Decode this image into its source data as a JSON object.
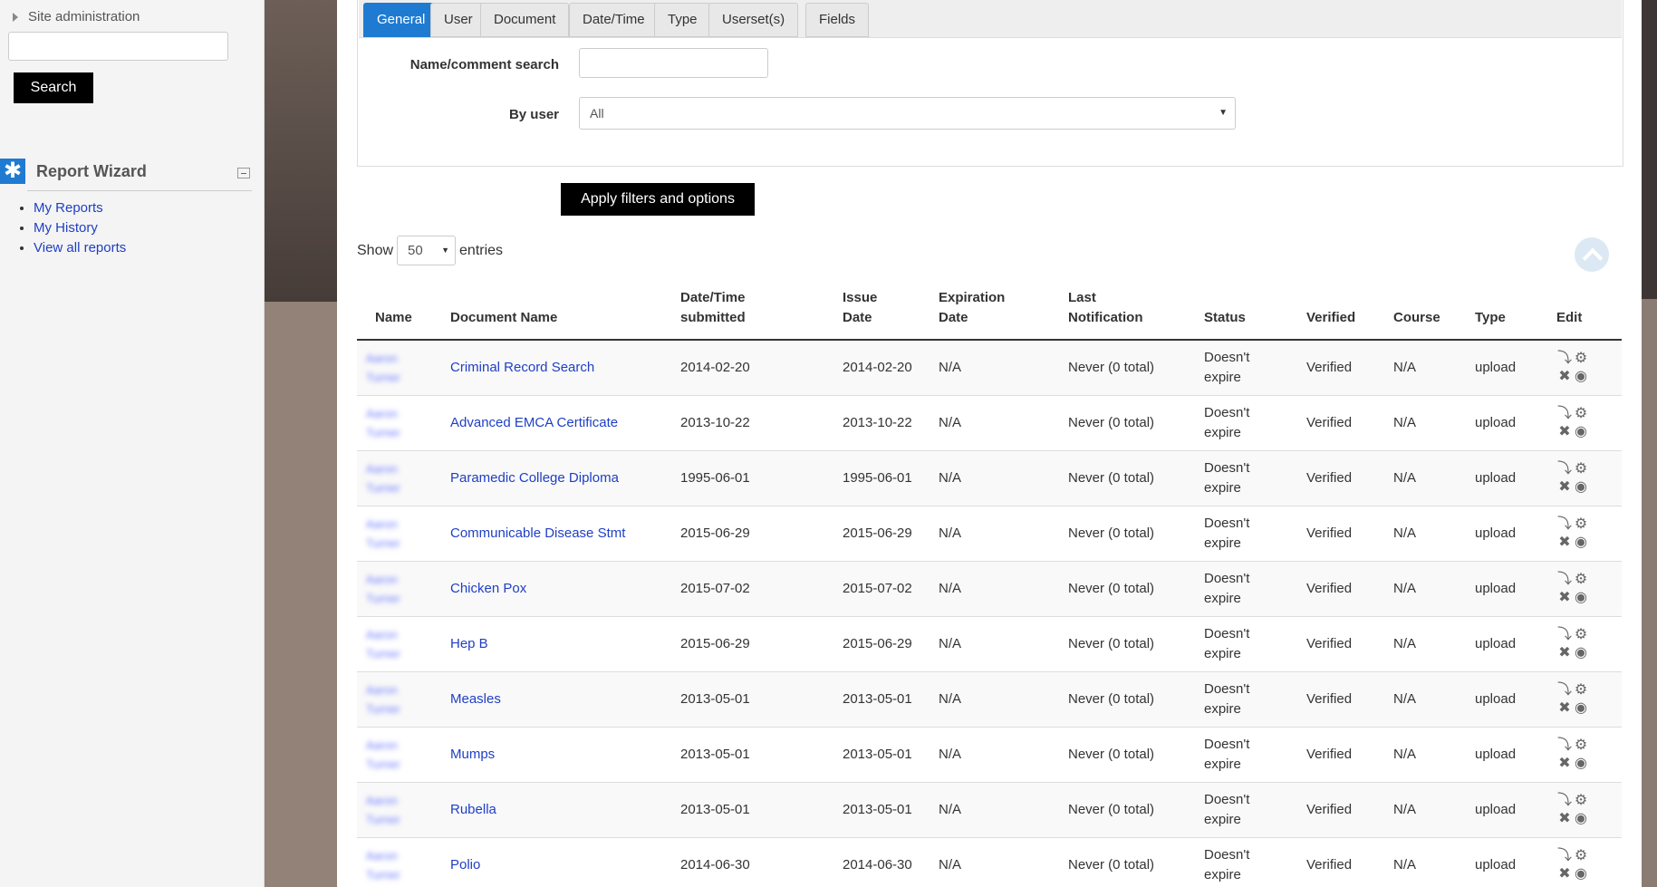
{
  "sidebar": {
    "site_admin_label": "Site administration",
    "search_button": "Search",
    "report_wizard": {
      "title": "Report Wizard",
      "links": [
        "My Reports",
        "My History",
        "View all reports"
      ]
    }
  },
  "filters": {
    "tabs": [
      "General",
      "User",
      "Document",
      "Date/Time",
      "Type",
      "Userset(s)",
      "Fields"
    ],
    "active_tab": "General",
    "name_comment_label": "Name/comment search",
    "name_comment_value": "",
    "by_user_label": "By user",
    "by_user_value": "All",
    "apply_button": "Apply filters and options"
  },
  "entries": {
    "show_label": "Show",
    "value": "50",
    "entries_label": "entries"
  },
  "table": {
    "headers": {
      "name": "Name",
      "document_name": "Document Name",
      "submitted_1": "Date/Time",
      "submitted_2": "submitted",
      "issue_1": "Issue",
      "issue_2": "Date",
      "expiration_1": "Expiration",
      "expiration_2": "Date",
      "last_notification_1": "Last",
      "last_notification_2": "Notification",
      "status": "Status",
      "verified": "Verified",
      "course": "Course",
      "type": "Type",
      "edit": "Edit"
    },
    "rows": [
      {
        "name1": "Aaron",
        "name2": "Turner",
        "document": "Criminal Record Search",
        "submitted": "2014-02-20",
        "issue": "2014-02-20",
        "expiration": "N/A",
        "notification": "Never (0 total)",
        "status1": "Doesn't",
        "status2": "expire",
        "verified": "Verified",
        "course": "N/A",
        "type": "upload"
      },
      {
        "name1": "Aaron",
        "name2": "Turner",
        "document": "Advanced EMCA Certificate",
        "submitted": "2013-10-22",
        "issue": "2013-10-22",
        "expiration": "N/A",
        "notification": "Never (0 total)",
        "status1": "Doesn't",
        "status2": "expire",
        "verified": "Verified",
        "course": "N/A",
        "type": "upload"
      },
      {
        "name1": "Aaron",
        "name2": "Turner",
        "document": "Paramedic College Diploma",
        "submitted": "1995-06-01",
        "issue": "1995-06-01",
        "expiration": "N/A",
        "notification": "Never (0 total)",
        "status1": "Doesn't",
        "status2": "expire",
        "verified": "Verified",
        "course": "N/A",
        "type": "upload"
      },
      {
        "name1": "Aaron",
        "name2": "Turner",
        "document": "Communicable Disease Stmt",
        "submitted": "2015-06-29",
        "issue": "2015-06-29",
        "expiration": "N/A",
        "notification": "Never (0 total)",
        "status1": "Doesn't",
        "status2": "expire",
        "verified": "Verified",
        "course": "N/A",
        "type": "upload"
      },
      {
        "name1": "Aaron",
        "name2": "Turner",
        "document": "Chicken Pox",
        "submitted": "2015-07-02",
        "issue": "2015-07-02",
        "expiration": "N/A",
        "notification": "Never (0 total)",
        "status1": "Doesn't",
        "status2": "expire",
        "verified": "Verified",
        "course": "N/A",
        "type": "upload"
      },
      {
        "name1": "Aaron",
        "name2": "Turner",
        "document": "Hep B",
        "submitted": "2015-06-29",
        "issue": "2015-06-29",
        "expiration": "N/A",
        "notification": "Never (0 total)",
        "status1": "Doesn't",
        "status2": "expire",
        "verified": "Verified",
        "course": "N/A",
        "type": "upload"
      },
      {
        "name1": "Aaron",
        "name2": "Turner",
        "document": "Measles",
        "submitted": "2013-05-01",
        "issue": "2013-05-01",
        "expiration": "N/A",
        "notification": "Never (0 total)",
        "status1": "Doesn't",
        "status2": "expire",
        "verified": "Verified",
        "course": "N/A",
        "type": "upload"
      },
      {
        "name1": "Aaron",
        "name2": "Turner",
        "document": "Mumps",
        "submitted": "2013-05-01",
        "issue": "2013-05-01",
        "expiration": "N/A",
        "notification": "Never (0 total)",
        "status1": "Doesn't",
        "status2": "expire",
        "verified": "Verified",
        "course": "N/A",
        "type": "upload"
      },
      {
        "name1": "Aaron",
        "name2": "Turner",
        "document": "Rubella",
        "submitted": "2013-05-01",
        "issue": "2013-05-01",
        "expiration": "N/A",
        "notification": "Never (0 total)",
        "status1": "Doesn't",
        "status2": "expire",
        "verified": "Verified",
        "course": "N/A",
        "type": "upload"
      },
      {
        "name1": "Aaron",
        "name2": "Turner",
        "document": "Polio",
        "submitted": "2014-06-30",
        "issue": "2014-06-30",
        "expiration": "N/A",
        "notification": "Never (0 total)",
        "status1": "Doesn't",
        "status2": "expire",
        "verified": "Verified",
        "course": "N/A",
        "type": "upload"
      }
    ]
  },
  "colors": {
    "accent": "#1f7bd1",
    "link": "#1f3fc4",
    "verified": "#44cc33"
  },
  "icons": {
    "row_actions": [
      "download-icon",
      "gear-icon",
      "delete-icon",
      "view-icon"
    ]
  }
}
